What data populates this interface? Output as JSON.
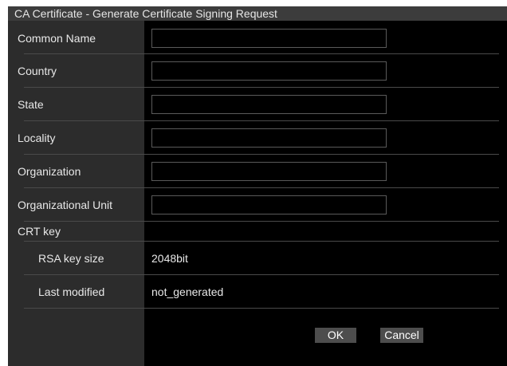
{
  "dialog": {
    "title": "CA Certificate - Generate Certificate Signing Request"
  },
  "fields": {
    "common_name": {
      "label": "Common Name",
      "value": ""
    },
    "country": {
      "label": "Country",
      "value": ""
    },
    "state": {
      "label": "State",
      "value": ""
    },
    "locality": {
      "label": "Locality",
      "value": ""
    },
    "organization": {
      "label": "Organization",
      "value": ""
    },
    "organizational_unit": {
      "label": "Organizational Unit",
      "value": ""
    }
  },
  "crt_key": {
    "label": "CRT key",
    "rsa_key_size_label": "RSA key size",
    "rsa_key_size_value": "2048bit",
    "last_modified_label": "Last modified",
    "last_modified_value": "not_generated"
  },
  "buttons": {
    "ok_label": "OK",
    "cancel_label": "Cancel"
  }
}
